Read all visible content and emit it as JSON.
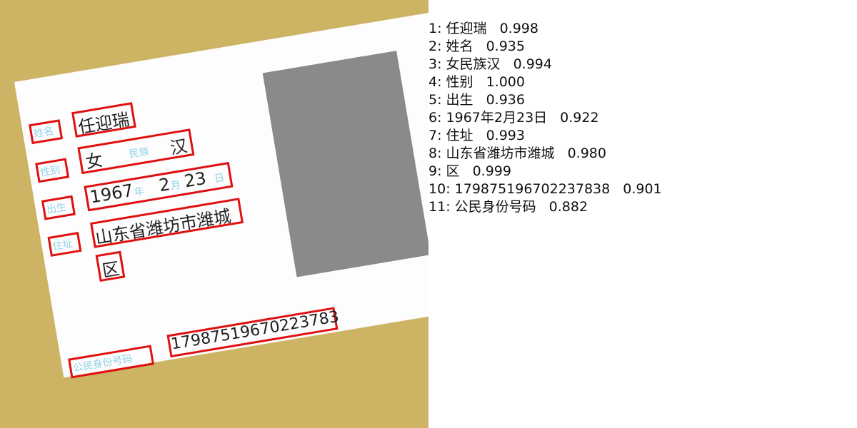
{
  "card": {
    "label_name": "姓名",
    "value_name": "任迎瑞",
    "label_sex": "性别",
    "value_sex": "女",
    "label_ethnicity": "民族",
    "value_ethnicity": "汉",
    "label_birth": "出生",
    "birth_year": "1967",
    "birth_year_unit": "年",
    "birth_month": "2",
    "birth_month_unit": "月",
    "birth_day": "23",
    "birth_day_unit": "日",
    "label_address": "住址",
    "value_address_line1": "山东省潍坊市潍城",
    "value_address_line2": "区",
    "label_id": "公民身份号码",
    "value_id": "17987519670223783"
  },
  "results": [
    {
      "index": "1",
      "text": "任迎瑞",
      "score": "0.998"
    },
    {
      "index": "2",
      "text": "姓名",
      "score": "0.935"
    },
    {
      "index": "3",
      "text": "女民族汉",
      "score": "0.994"
    },
    {
      "index": "4",
      "text": "性别",
      "score": "1.000"
    },
    {
      "index": "5",
      "text": "出生",
      "score": "0.936"
    },
    {
      "index": "6",
      "text": "1967年2月23日",
      "score": "0.922"
    },
    {
      "index": "7",
      "text": "住址",
      "score": "0.993"
    },
    {
      "index": "8",
      "text": "山东省潍坊市潍城",
      "score": "0.980"
    },
    {
      "index": "9",
      "text": "区",
      "score": "0.999"
    },
    {
      "index": "10",
      "text": "17987519670223783​8",
      "score": "0.901"
    },
    {
      "index": "11",
      "text": "公民身份号码",
      "score": "0.882"
    }
  ]
}
